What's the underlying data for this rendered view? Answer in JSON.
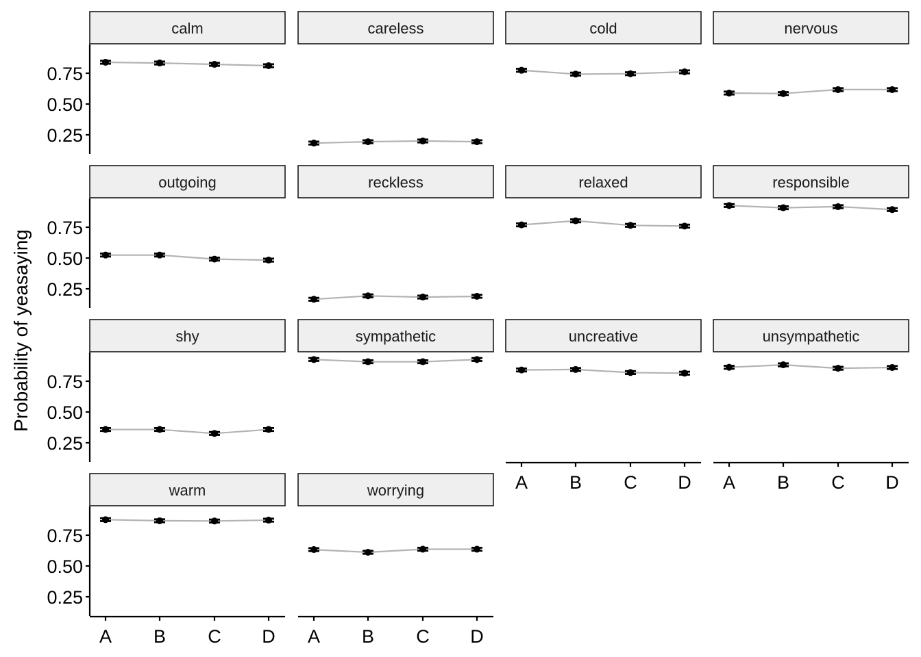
{
  "chart_data": {
    "type": "line",
    "title": "",
    "xlabel": "",
    "ylabel": "Probability of yeasaying",
    "categories": [
      "A",
      "B",
      "C",
      "D"
    ],
    "y_ticks": [
      0.25,
      0.5,
      0.75
    ],
    "y_tick_labels": [
      "0.25",
      "0.50",
      "0.75"
    ],
    "ylim": [
      0.12,
      0.96
    ],
    "grid": false,
    "legend": "none",
    "facet_layout": "4 columns, wrap",
    "series_color": "#b3b3b3",
    "point_color": "#000000",
    "strip_fill": "#efefef",
    "error_halfwidth_approx": 0.012,
    "panels": [
      {
        "name": "calm",
        "values": [
          0.839,
          0.833,
          0.822,
          0.811
        ]
      },
      {
        "name": "careless",
        "values": [
          0.183,
          0.194,
          0.2,
          0.194
        ]
      },
      {
        "name": "cold",
        "values": [
          0.774,
          0.743,
          0.746,
          0.761
        ]
      },
      {
        "name": "nervous",
        "values": [
          0.589,
          0.585,
          0.617,
          0.617
        ]
      },
      {
        "name": "outgoing",
        "values": [
          0.524,
          0.524,
          0.491,
          0.483
        ]
      },
      {
        "name": "reckless",
        "values": [
          0.165,
          0.193,
          0.183,
          0.189
        ]
      },
      {
        "name": "relaxed",
        "values": [
          0.769,
          0.802,
          0.765,
          0.759
        ]
      },
      {
        "name": "responsible",
        "values": [
          0.926,
          0.908,
          0.917,
          0.893
        ]
      },
      {
        "name": "shy",
        "values": [
          0.358,
          0.358,
          0.326,
          0.358
        ]
      },
      {
        "name": "sympathetic",
        "values": [
          0.926,
          0.908,
          0.908,
          0.926
        ]
      },
      {
        "name": "uncreative",
        "values": [
          0.841,
          0.845,
          0.82,
          0.815
        ]
      },
      {
        "name": "unsympathetic",
        "values": [
          0.863,
          0.883,
          0.855,
          0.861
        ]
      },
      {
        "name": "warm",
        "values": [
          0.876,
          0.867,
          0.865,
          0.872
        ]
      },
      {
        "name": "worrying",
        "values": [
          0.633,
          0.611,
          0.636,
          0.636
        ]
      }
    ]
  }
}
